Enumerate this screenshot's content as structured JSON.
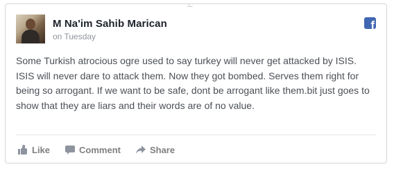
{
  "post": {
    "author": "M Na'im Sahib Marican",
    "timestamp": "on Tuesday",
    "text": "Some Turkish atrocious ogre used to say turkey will never get attacked by ISIS. ISIS will never dare to attack them. Now they got bombed. Serves them right for being so arrogant. If we want to be safe, dont be arrogant like them.bit just goes to show that they are liars and their words are of no value.",
    "brand_icon": "facebook-icon",
    "brand_color": "#4267b2"
  },
  "actions": {
    "like_label": "Like",
    "comment_label": "Comment",
    "share_label": "Share"
  }
}
